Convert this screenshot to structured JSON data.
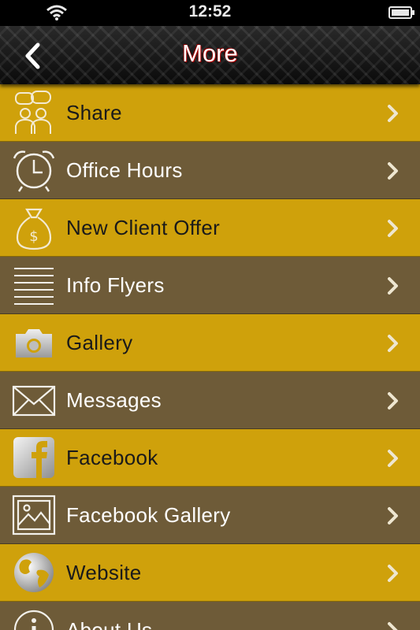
{
  "status_bar": {
    "time": "12:52"
  },
  "nav": {
    "title": "More",
    "back_icon": "chevron-left-icon"
  },
  "colors": {
    "gold": "#cfa10b",
    "brown": "#6e5b38",
    "title_shadow": "#c00000"
  },
  "menu": {
    "items": [
      {
        "label": "Share",
        "icon": "share-people-icon"
      },
      {
        "label": "Office Hours",
        "icon": "alarm-clock-icon"
      },
      {
        "label": "New Client Offer",
        "icon": "money-bag-icon"
      },
      {
        "label": "Info Flyers",
        "icon": "lines-list-icon"
      },
      {
        "label": "Gallery",
        "icon": "camera-icon"
      },
      {
        "label": "Messages",
        "icon": "envelope-icon"
      },
      {
        "label": "Facebook",
        "icon": "facebook-icon"
      },
      {
        "label": "Facebook Gallery",
        "icon": "picture-frame-icon"
      },
      {
        "label": "Website",
        "icon": "globe-icon"
      },
      {
        "label": "About Us",
        "icon": "info-icon"
      }
    ]
  }
}
